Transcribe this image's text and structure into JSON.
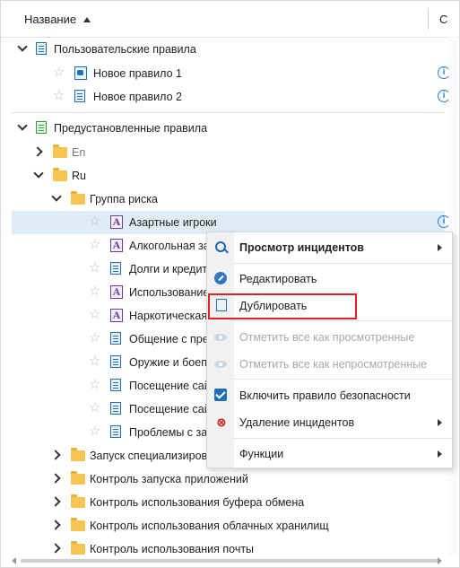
{
  "header": {
    "column_title": "Название",
    "column2_partial": "С"
  },
  "tree": {
    "user_rules": {
      "label": "Пользовательские правила",
      "items": [
        {
          "label": "Новое правило 1"
        },
        {
          "label": "Новое правило 2"
        }
      ]
    },
    "preset_rules": {
      "label": "Предустановленные правила"
    },
    "en": {
      "label": "En"
    },
    "ru": {
      "label": "Ru"
    },
    "risk_group": {
      "label": "Группа риска",
      "items": [
        {
          "label": "Азартные игроки"
        },
        {
          "label": "Алкогольная зав"
        },
        {
          "label": "Долги и кредиты"
        },
        {
          "label": "Использование"
        },
        {
          "label": "Наркотическая"
        },
        {
          "label": "Общение с прес"
        },
        {
          "label": "Оружие и боепр"
        },
        {
          "label": "Посещение сайт"
        },
        {
          "label": "Посещение сайт"
        },
        {
          "label": "Проблемы с зак"
        }
      ]
    },
    "folders": [
      {
        "label": "Запуск специализирова"
      },
      {
        "label": "Контроль запуска приложений"
      },
      {
        "label": "Контроль использования буфера обмена"
      },
      {
        "label": "Контроль использования облачных хранилищ"
      },
      {
        "label": "Контроль использования почты"
      }
    ]
  },
  "context_menu": {
    "view_incidents": "Просмотр инцидентов",
    "edit": "Редактировать",
    "duplicate": "Дублировать",
    "mark_all_viewed": "Отметить все как просмотренные",
    "mark_all_unviewed": "Отметить все как непросмотренные",
    "enable_rule": "Включить правило безопасности",
    "delete_incidents": "Удаление инцидентов",
    "functions": "Функции"
  },
  "colors": {
    "highlight": "#dfecf6",
    "accent": "#1f6fb8",
    "annotation_box": "#e02020"
  }
}
